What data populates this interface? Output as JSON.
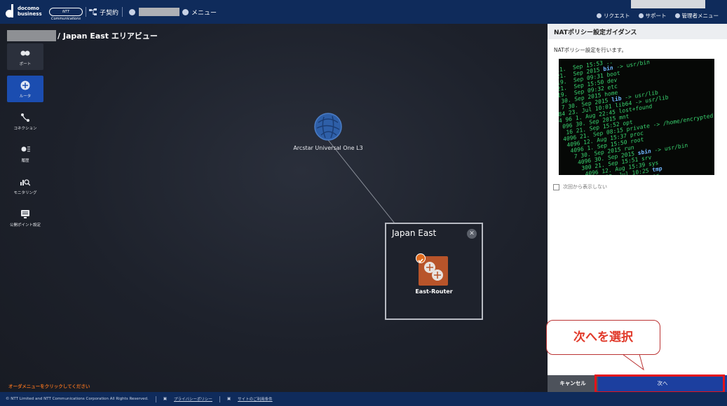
{
  "header": {
    "logo_line1": "docomo",
    "logo_line2": "business",
    "ntt_logo_text": "NTT Communications",
    "contract_label": "子契約",
    "menu_label": "メニュー",
    "links": [
      "リクエスト",
      "サポート",
      "管理者メニュー"
    ]
  },
  "breadcrumb": {
    "current": "/ Japan East エリアビュー"
  },
  "sidebar": {
    "items": [
      {
        "label": "ポート",
        "icon": "port-icon"
      },
      {
        "label": "ルータ",
        "icon": "router-icon"
      },
      {
        "label": "コネクション",
        "icon": "connection-icon"
      },
      {
        "label": "履歴",
        "icon": "history-icon"
      },
      {
        "label": "モニタリング",
        "icon": "monitoring-icon"
      },
      {
        "label": "公開ポイント設定",
        "icon": "public-point-icon"
      }
    ]
  },
  "canvas": {
    "globe_label": "Arcstar Universal One L3",
    "region_title": "Japan East",
    "router_label": "East-Router",
    "order_message": "オーダメニューをクリックしてください"
  },
  "panel": {
    "title": "NATポリシー設定ガイダンス",
    "description": "NATポリシー設定を行います。",
    "dont_show": "次回から表示しない",
    "cancel": "キャンセル",
    "next": "次へ"
  },
  "callout": {
    "text": "次へを選択"
  },
  "footer": {
    "copyright": "© NTT Limited and NTT Communications Corporation All Rights Reserved.",
    "privacy": "プライバシーポリシー",
    "terms": "サイトのご利用条件"
  },
  "colors": {
    "topbar": "#0f2b5b",
    "active_nav": "#1b4db0",
    "next_button": "#1c3f9f",
    "highlight": "#e4131a",
    "router": "#b8542a",
    "accent_orange": "#e06c1f"
  }
}
